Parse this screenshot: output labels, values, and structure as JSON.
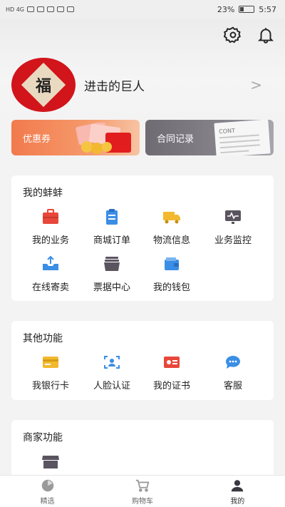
{
  "status_bar": {
    "left": "HD 4G",
    "battery": "23%",
    "time": "5:57"
  },
  "header": {
    "settings_icon": "gear-icon",
    "notification_icon": "bell-icon"
  },
  "profile": {
    "avatar_char": "福",
    "name": "进击的巨人",
    "arrow": ">"
  },
  "promos": {
    "coupon_label": "优惠券",
    "contract_label": "合同记录",
    "contract_art_text": "CONT"
  },
  "my_bengbeng": {
    "title": "我的蚌蚌",
    "items": [
      {
        "label": "我的业务",
        "icon": "briefcase-icon"
      },
      {
        "label": "商城订单",
        "icon": "clipboard-icon"
      },
      {
        "label": "物流信息",
        "icon": "truck-icon"
      },
      {
        "label": "业务监控",
        "icon": "monitor-icon"
      },
      {
        "label": "在线寄卖",
        "icon": "upload-tray-icon"
      },
      {
        "label": "票据中心",
        "icon": "ticket-stack-icon"
      },
      {
        "label": "我的钱包",
        "icon": "wallet-icon"
      }
    ]
  },
  "other_functions": {
    "title": "其他功能",
    "items": [
      {
        "label": "我银行卡",
        "icon": "bank-card-icon"
      },
      {
        "label": "人脸认证",
        "icon": "face-scan-icon"
      },
      {
        "label": "我的证书",
        "icon": "certificate-icon"
      },
      {
        "label": "客服",
        "icon": "chat-bubble-icon"
      }
    ]
  },
  "merchant_functions": {
    "title": "商家功能",
    "items": [
      {
        "label": "",
        "icon": "store-icon"
      }
    ]
  },
  "tabbar": {
    "tabs": [
      {
        "label": "精选",
        "icon": "featured-icon",
        "active": false
      },
      {
        "label": "购物车",
        "icon": "cart-icon",
        "active": false
      },
      {
        "label": "我的",
        "icon": "user-icon",
        "active": true
      }
    ]
  },
  "colors": {
    "accent_orange": "#f27a4d",
    "card_bg": "#ffffff",
    "page_bg": "#f3f3f3",
    "avatar_red": "#d2141b"
  }
}
